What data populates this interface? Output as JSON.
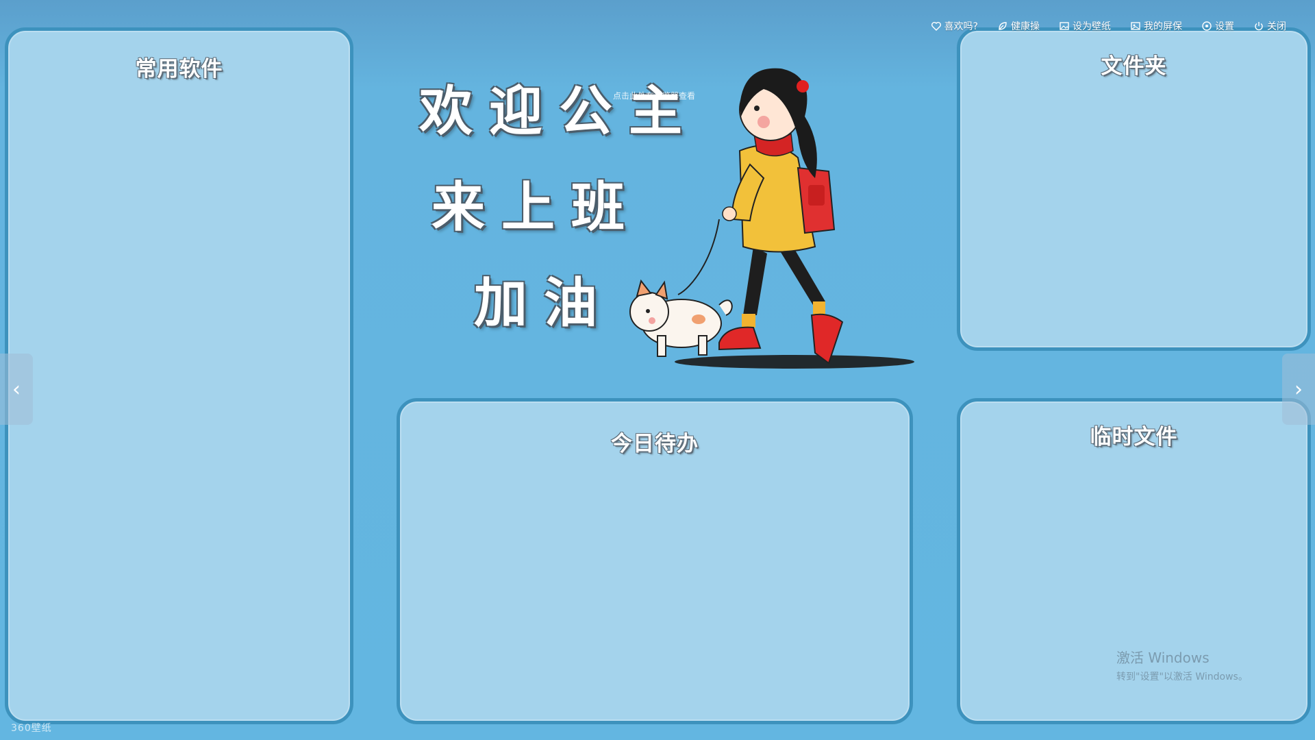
{
  "top_menu": {
    "like": "喜欢吗?",
    "exercise": "健康操",
    "set_wallpaper": "设为壁纸",
    "my_screensaver": "我的屏保",
    "settings": "设置",
    "close": "关闭"
  },
  "panels": {
    "apps_title": "常用软件",
    "folder_title": "文件夹",
    "todo_title": "今日待办",
    "temp_title": "临时文件"
  },
  "welcome": {
    "line1": "欢迎公主",
    "line2": "来上班",
    "line3": "加油"
  },
  "hint": "点击此处在浏览器查看",
  "nav": {
    "prev": "‹",
    "next": "›"
  },
  "activation": {
    "title": "激活 Windows",
    "subtitle": "转到\"设置\"以激活 Windows。"
  },
  "brand": "360壁纸",
  "icons": [
    "heart-icon",
    "leaf-icon",
    "wallpaper-icon",
    "screensaver-icon",
    "settings-icon",
    "power-icon"
  ]
}
